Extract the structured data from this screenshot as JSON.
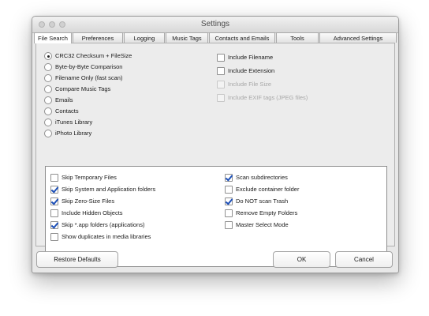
{
  "window": {
    "title": "Settings"
  },
  "tabs": [
    {
      "label": "File Search",
      "active": true
    },
    {
      "label": "Preferences"
    },
    {
      "label": "Logging"
    },
    {
      "label": "Music Tags"
    },
    {
      "label": "Contacts and Emails"
    },
    {
      "label": "Tools"
    },
    {
      "label": "Advanced Settings"
    }
  ],
  "search_method": {
    "selected": "CRC32 Checksum + FileSize",
    "options": [
      "CRC32 Checksum + FileSize",
      "Byte-by-Byte Comparison",
      "Filename Only (fast scan)",
      "Compare Music Tags",
      "Emails",
      "Contacts",
      "iTunes Library",
      "iPhoto Library"
    ]
  },
  "include_options": [
    {
      "label": "Include Filename",
      "checked": false,
      "enabled": true
    },
    {
      "label": "Include Extension",
      "checked": false,
      "enabled": true
    },
    {
      "label": "Include File Size",
      "checked": false,
      "enabled": false
    },
    {
      "label": "Include EXIF tags (JPEG files)",
      "checked": false,
      "enabled": false
    }
  ],
  "scan_options_left": [
    {
      "label": "Skip Temporary Files",
      "checked": false
    },
    {
      "label": "Skip System and Application folders",
      "checked": true
    },
    {
      "label": "Skip Zero-Size Files",
      "checked": true
    },
    {
      "label": "Include Hidden Objects",
      "checked": false
    },
    {
      "label": "Skip *.app folders (applications)",
      "checked": true
    },
    {
      "label": "Show duplicates in media libraries",
      "checked": false
    }
  ],
  "scan_options_right": [
    {
      "label": "Scan subdirectories",
      "checked": true
    },
    {
      "label": "Exclude container folder",
      "checked": false
    },
    {
      "label": "Do NOT scan Trash",
      "checked": true
    },
    {
      "label": "Remove Empty Folders",
      "checked": false
    },
    {
      "label": "Master Select Mode",
      "checked": false
    }
  ],
  "buttons": {
    "restore": "Restore Defaults",
    "ok": "OK",
    "cancel": "Cancel"
  },
  "colors": {
    "check_mark": "#1c4fb8"
  }
}
